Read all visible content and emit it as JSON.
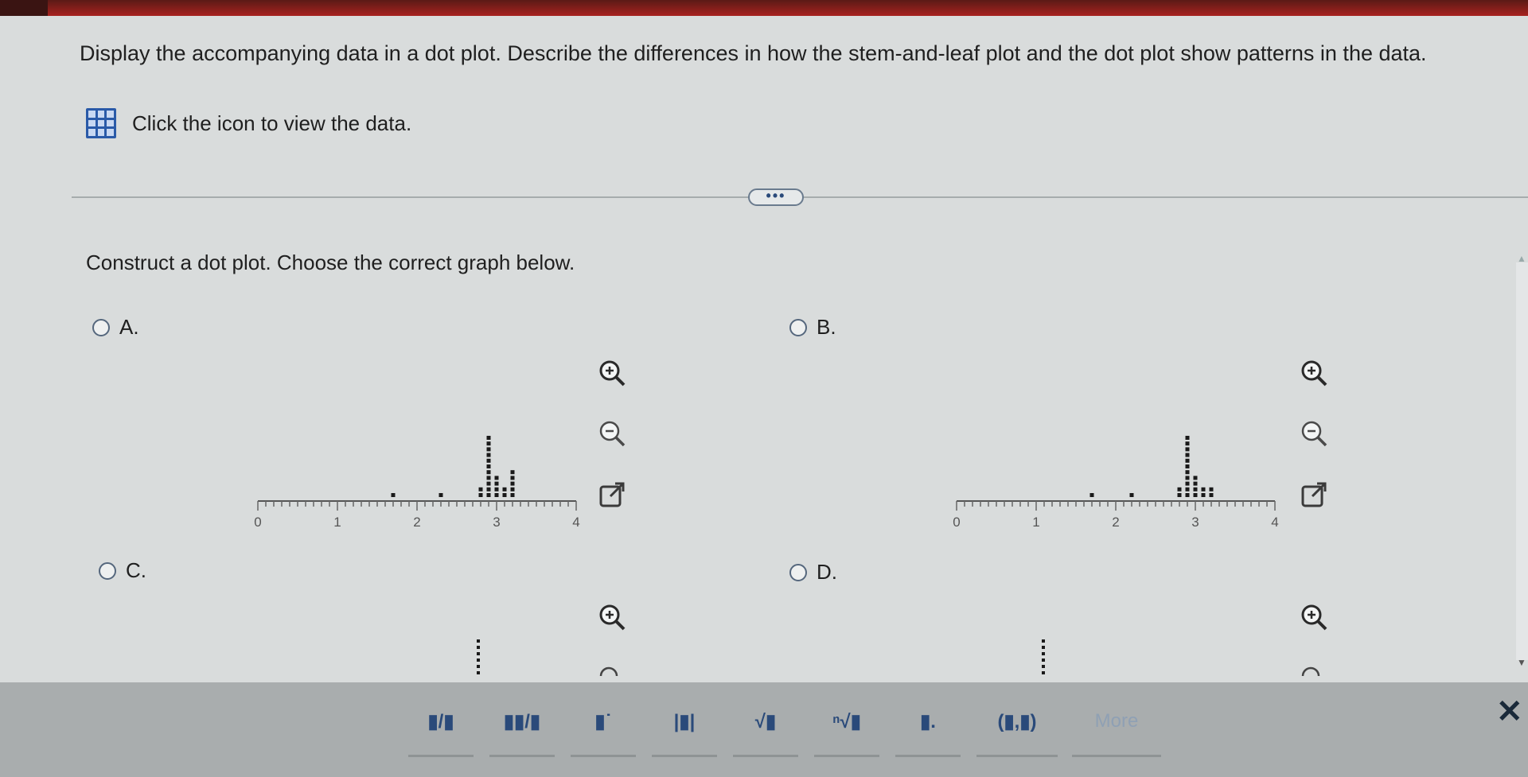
{
  "prompt": "Display the accompanying data in a dot plot. Describe the differences in how the stem-and-leaf plot and the dot plot show patterns in the data.",
  "data_link": {
    "label": "Click the icon to view the data."
  },
  "more_button": {
    "label": "•••"
  },
  "question": "Construct a dot plot. Choose the correct graph below.",
  "options": [
    {
      "label": "A."
    },
    {
      "label": "B."
    },
    {
      "label": "C."
    },
    {
      "label": "D."
    }
  ],
  "axis_ticks": [
    "0",
    "1",
    "2",
    "3",
    "4"
  ],
  "plots": [
    {
      "option": "A",
      "stacks": [
        {
          "x": 1.7,
          "n": 1
        },
        {
          "x": 2.3,
          "n": 1
        },
        {
          "x": 2.8,
          "n": 2
        },
        {
          "x": 2.9,
          "n": 11
        },
        {
          "x": 3.0,
          "n": 4
        },
        {
          "x": 3.1,
          "n": 2
        },
        {
          "x": 3.2,
          "n": 5
        }
      ]
    },
    {
      "option": "B",
      "stacks": [
        {
          "x": 1.7,
          "n": 1
        },
        {
          "x": 2.2,
          "n": 1
        },
        {
          "x": 2.8,
          "n": 2
        },
        {
          "x": 2.9,
          "n": 11
        },
        {
          "x": 3.0,
          "n": 4
        },
        {
          "x": 3.1,
          "n": 2
        },
        {
          "x": 3.2,
          "n": 2
        }
      ]
    }
  ],
  "toolbar": {
    "buttons": [
      {
        "name": "fraction-button",
        "label": "▮/▮"
      },
      {
        "name": "mixed-number-button",
        "label": "▮▮/▮"
      },
      {
        "name": "exponent-button",
        "label": "▮˙"
      },
      {
        "name": "absolute-value-button",
        "label": "|▮|"
      },
      {
        "name": "square-root-button",
        "label": "√▮"
      },
      {
        "name": "nth-root-button",
        "label": "ⁿ√▮"
      },
      {
        "name": "subscript-button",
        "label": "▮."
      },
      {
        "name": "ordered-pair-button",
        "label": "(▮,▮)"
      },
      {
        "name": "more-symbols-button",
        "label": "More"
      }
    ]
  }
}
